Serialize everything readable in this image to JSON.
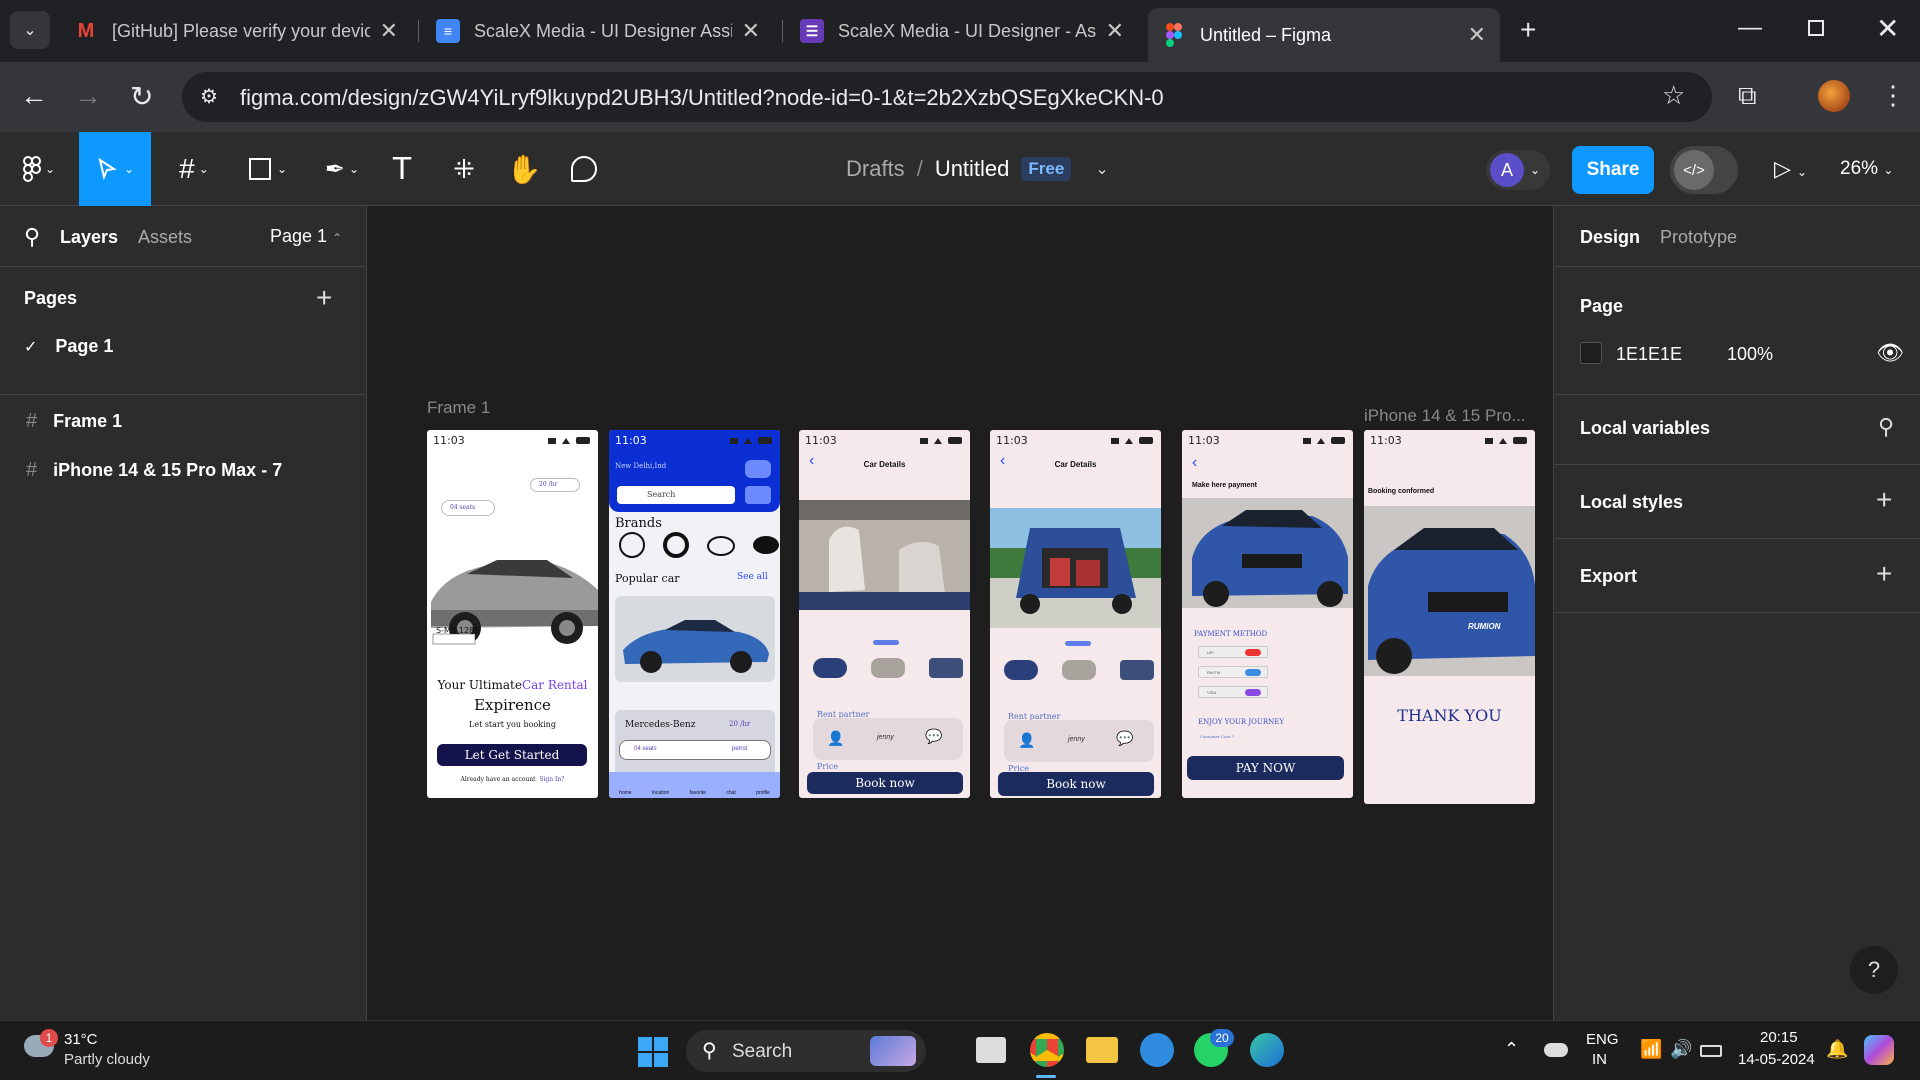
{
  "browser": {
    "tabs": [
      {
        "title": "[GitHub] Please verify your device",
        "icon": "gmail-icon",
        "active": false
      },
      {
        "title": "ScaleX Media - UI Designer Assign",
        "icon": "docs-icon",
        "active": false
      },
      {
        "title": "ScaleX Media - UI Designer - Assig",
        "icon": "forms-icon",
        "active": false
      },
      {
        "title": "Untitled – Figma",
        "icon": "figma-icon",
        "active": true
      }
    ],
    "url": "figma.com/design/zGW4YiLryf9lkuypd2UBH3/Untitled?node-id=0-1&t=2b2XzbQSEgXkeCKN-0"
  },
  "figma": {
    "breadcrumb_drafts": "Drafts",
    "breadcrumb_sep": "/",
    "file_name": "Untitled",
    "plan_badge": "Free",
    "avatar_letter": "A",
    "share_label": "Share",
    "zoom": "26%",
    "left_tabs": {
      "layers": "Layers",
      "assets": "Assets",
      "page": "Page 1"
    },
    "pages_heading": "Pages",
    "pages": [
      "Page 1"
    ],
    "layers": [
      "Frame 1",
      "iPhone 14 & 15 Pro Max - 7"
    ],
    "right_tabs": {
      "design": "Design",
      "prototype": "Prototype"
    },
    "page_section": "Page",
    "page_color": "1E1E1E",
    "page_opacity": "100%",
    "sections": [
      "Local variables",
      "Local styles",
      "Export"
    ],
    "canvas_labels": {
      "frame1": "Frame 1",
      "iphone": "iPhone 14 & 15 Pro..."
    }
  },
  "phones": {
    "time": "11:03",
    "p1": {
      "seats": "04 seats",
      "price": "20 /hr",
      "plate": "S-MB 1286",
      "headline_a": "Your Ultimate",
      "headline_b": "Car Rental",
      "headline_c": "Expirence",
      "sub": "Let start you booking",
      "cta": "Let Get Started",
      "footer": "Already have an account",
      "signin": "Sign In?"
    },
    "p2": {
      "location": "New Delhi,Ind",
      "search": "Search",
      "brands": "Brands",
      "popular": "Popular car",
      "see_all": "See all",
      "car_name": "Mercedes-Benz",
      "price": "20 /hr",
      "seats": "04 seats",
      "fuel": "petrol",
      "nav": [
        "home",
        "location",
        "favorite",
        "chat",
        "profile"
      ]
    },
    "p3": {
      "title": "Car Details",
      "rent": "Rent partner",
      "name": "jenny",
      "price": "Price",
      "cta": "Book now"
    },
    "p4": {
      "title": "Car Details",
      "rent": "Rent partner",
      "name": "jenny",
      "price": "Price",
      "cta": "Book now"
    },
    "p5": {
      "title": "Make here payment",
      "method": "PAYMENT METHOD",
      "opts": [
        "UPI",
        "PAYTM",
        "VISA"
      ],
      "enjoy": "ENJOY YOUR JOURNEY",
      "note": "Customer Care ?",
      "cta": "PAY NOW"
    },
    "p6": {
      "title": "Booking conformed",
      "thanks": "THANK YOU",
      "badge": "RUMION"
    }
  },
  "taskbar": {
    "temp": "31°C",
    "weather": "Partly cloudy",
    "weather_badge": "1",
    "search": "Search",
    "whatsapp_badge": "20",
    "lang1": "ENG",
    "lang2": "IN",
    "time": "20:15",
    "date": "14-05-2024"
  }
}
